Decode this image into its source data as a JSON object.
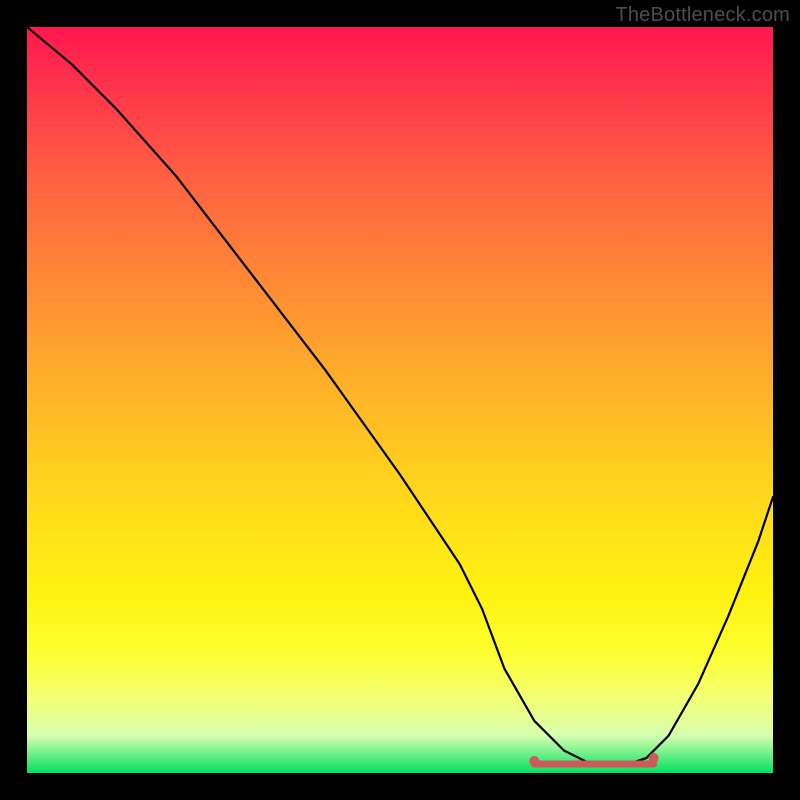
{
  "watermark": "TheBottleneck.com",
  "colors": {
    "page_bg": "#000000",
    "watermark": "#4d4d4d",
    "curve": "#000000",
    "marker": "#cc5a5a",
    "gradient_top": "#ff1750",
    "gradient_bottom": "#00e060"
  },
  "chart_data": {
    "type": "line",
    "title": "",
    "xlabel": "",
    "ylabel": "",
    "xlim": [
      0,
      100
    ],
    "ylim": [
      0,
      100
    ],
    "grid": false,
    "series": [
      {
        "name": "bottleneck-curve",
        "x": [
          0,
          6,
          12,
          20,
          30,
          40,
          50,
          58,
          61,
          64,
          68,
          72,
          76,
          80,
          83,
          86,
          90,
          94,
          98,
          100
        ],
        "values": [
          100,
          95,
          89,
          80,
          67,
          54,
          40,
          28,
          22,
          14,
          7,
          3,
          1,
          1,
          2,
          5,
          12,
          21,
          31,
          37
        ]
      }
    ],
    "highlight_band": {
      "name": "optimal-range",
      "x_start": 68,
      "x_end": 84,
      "y": 1.2
    },
    "annotations": []
  }
}
